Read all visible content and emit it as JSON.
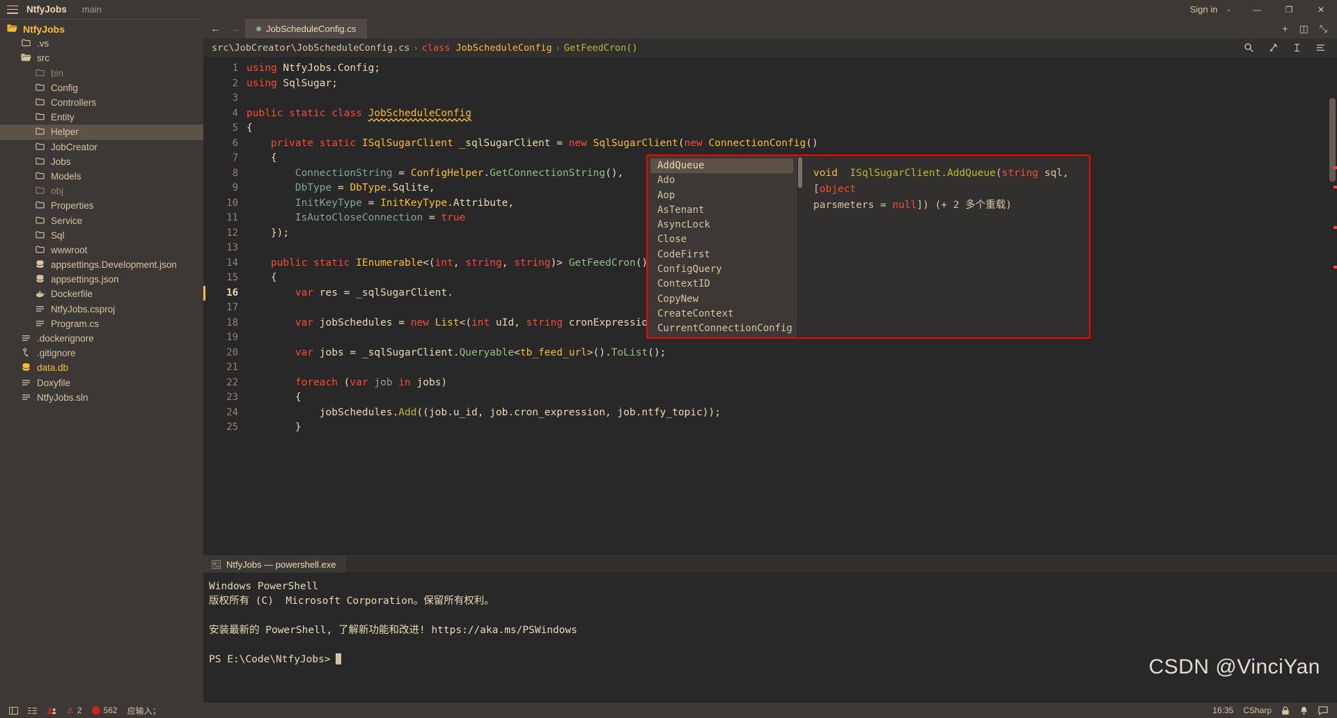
{
  "titlebar": {
    "menu_icon": "hamburger-icon",
    "project": "NtfyJobs",
    "branch": "main",
    "sign_in": "Sign in",
    "caret": "⌄",
    "minimize": "—",
    "maximize": "❐",
    "close": "✕"
  },
  "sidebar": {
    "items": [
      {
        "label": "NtfyJobs",
        "icon": "folder-open-icon",
        "indent": 0,
        "kind": "root"
      },
      {
        "label": ".vs",
        "icon": "folder-icon",
        "indent": 1,
        "kind": "folder"
      },
      {
        "label": "src",
        "icon": "folder-open-icon",
        "indent": 1,
        "kind": "folder"
      },
      {
        "label": "bin",
        "icon": "folder-icon",
        "indent": 2,
        "kind": "folder-dim"
      },
      {
        "label": "Config",
        "icon": "folder-icon",
        "indent": 2,
        "kind": "folder"
      },
      {
        "label": "Controllers",
        "icon": "folder-icon",
        "indent": 2,
        "kind": "folder"
      },
      {
        "label": "Entity",
        "icon": "folder-icon",
        "indent": 2,
        "kind": "folder"
      },
      {
        "label": "Helper",
        "icon": "folder-icon",
        "indent": 2,
        "kind": "folder-selected"
      },
      {
        "label": "JobCreator",
        "icon": "folder-icon",
        "indent": 2,
        "kind": "folder"
      },
      {
        "label": "Jobs",
        "icon": "folder-icon",
        "indent": 2,
        "kind": "folder"
      },
      {
        "label": "Models",
        "icon": "folder-icon",
        "indent": 2,
        "kind": "folder"
      },
      {
        "label": "obj",
        "icon": "folder-icon",
        "indent": 2,
        "kind": "folder-dim"
      },
      {
        "label": "Properties",
        "icon": "folder-icon",
        "indent": 2,
        "kind": "folder"
      },
      {
        "label": "Service",
        "icon": "folder-icon",
        "indent": 2,
        "kind": "folder"
      },
      {
        "label": "Sql",
        "icon": "folder-icon",
        "indent": 2,
        "kind": "folder"
      },
      {
        "label": "wwwroot",
        "icon": "folder-icon",
        "indent": 2,
        "kind": "folder"
      },
      {
        "label": "appsettings.Development.json",
        "icon": "database-icon",
        "indent": 2,
        "kind": "file"
      },
      {
        "label": "appsettings.json",
        "icon": "database-icon",
        "indent": 2,
        "kind": "file"
      },
      {
        "label": "Dockerfile",
        "icon": "docker-icon",
        "indent": 2,
        "kind": "file"
      },
      {
        "label": "NtfyJobs.csproj",
        "icon": "lines-icon",
        "indent": 2,
        "kind": "file"
      },
      {
        "label": "Program.cs",
        "icon": "lines-icon",
        "indent": 2,
        "kind": "file"
      },
      {
        "label": ".dockerignore",
        "icon": "lines-icon",
        "indent": 1,
        "kind": "file"
      },
      {
        "label": ".gitignore",
        "icon": "git-icon",
        "indent": 1,
        "kind": "file"
      },
      {
        "label": "data.db",
        "icon": "database-icon",
        "indent": 1,
        "kind": "file-db"
      },
      {
        "label": "Doxyfile",
        "icon": "lines-icon",
        "indent": 1,
        "kind": "file"
      },
      {
        "label": "NtfyJobs.sln",
        "icon": "lines-icon",
        "indent": 1,
        "kind": "file"
      }
    ]
  },
  "tabstrip": {
    "back": "←",
    "forward": "→",
    "tab_label": "JobScheduleConfig.cs",
    "add": "+",
    "split": "◫",
    "expand": "⤡"
  },
  "breadcrumb": {
    "path": "src\\JobCreator\\JobScheduleConfig.cs",
    "sep": "›",
    "keyword": "class",
    "type": "JobScheduleConfig",
    "member": "GetFeedCron()",
    "search_icon": "search-icon",
    "pin_icon": "pin-icon",
    "format_icon": "format-icon",
    "menu_icon": "more-icon"
  },
  "code": {
    "first_line": 1,
    "current_line": 16,
    "lines": [
      {
        "n": 1,
        "html": "<span class='k'>using</span> NtfyJobs.Config;"
      },
      {
        "n": 2,
        "html": "<span class='k'>using</span> SqlSugar;"
      },
      {
        "n": 3,
        "html": ""
      },
      {
        "n": 4,
        "html": "<span class='k'>public static class</span> <span class='t squig'>JobScheduleConfig</span>"
      },
      {
        "n": 5,
        "html": "{"
      },
      {
        "n": 6,
        "html": "    <span class='k'>private static</span> <span class='t'>ISqlSugarClient</span> _sqlSugarClient = <span class='k'>new</span> <span class='t'>SqlSugarClient</span>(<span class='k'>new</span> <span class='t'>ConnectionConfig</span>()"
      },
      {
        "n": 7,
        "html": "    {"
      },
      {
        "n": 8,
        "html": "        <span class='v'>ConnectionString</span> = <span class='t'>ConfigHelper</span>.<span class='m'>GetConnectionString</span>(),"
      },
      {
        "n": 9,
        "html": "        <span class='v'>DbType</span> = <span class='t'>DbType</span>.Sqlite,"
      },
      {
        "n": 10,
        "html": "        <span class='v'>InitKeyType</span> = <span class='t'>InitKeyType</span>.Attribute,"
      },
      {
        "n": 11,
        "html": "        <span class='v'>IsAutoCloseConnection</span> = <span class='k'>true</span>"
      },
      {
        "n": 12,
        "html": "    });"
      },
      {
        "n": 13,
        "html": ""
      },
      {
        "n": 14,
        "html": "    <span class='k'>public static</span> <span class='t'>IEnumerable</span>&lt;(<span class='k'>int</span>, <span class='k'>string</span>, <span class='k'>string</span>)&gt; <span class='m'>GetFeedCron</span>()"
      },
      {
        "n": 15,
        "html": "    {"
      },
      {
        "n": 16,
        "html": "        <span class='k'>var</span> res = _sqlSugarClient."
      },
      {
        "n": 17,
        "html": ""
      },
      {
        "n": 18,
        "html": "        <span class='k'>var</span> jobSchedules = <span class='k'>new</span> <span class='t'>List</span>&lt;(<span class='k'>int</span> uId, <span class='k'>string</span> cronExpression, <span class='k'>string</span> ntfyTopic)&gt;();"
      },
      {
        "n": 19,
        "html": ""
      },
      {
        "n": 20,
        "html": "        <span class='k'>var</span> jobs = _sqlSugarClient.<span class='m'>Queryable</span>&lt;<span class='t'>tb_feed_url</span>&gt;().<span class='m'>ToList</span>();"
      },
      {
        "n": 21,
        "html": ""
      },
      {
        "n": 22,
        "html": "        <span class='k'>foreach</span> (<span class='k'>var</span> <span class='v'>job</span> <span class='k'>in</span> jobs)"
      },
      {
        "n": 23,
        "html": "        {"
      },
      {
        "n": 24,
        "html": "            jobSchedules.<span class='g'>Add</span>((job.u_id, job.cron_expression, job.ntfy_topic));"
      },
      {
        "n": 25,
        "html": "        }"
      }
    ]
  },
  "intellisense": {
    "items": [
      "AddQueue",
      "Ado",
      "Aop",
      "AsTenant",
      "AsyncLock",
      "Close",
      "CodeFirst",
      "ConfigQuery",
      "ContextID",
      "CopyNew",
      "CreateContext",
      "CurrentConnectionConfig"
    ],
    "selected": "AddQueue",
    "signature": {
      "return_type": "void",
      "declaring_type": "ISqlSugarClient",
      "dot": ".",
      "method": "AddQueue",
      "open_paren": "(",
      "param1_type": "string",
      "param1_name": " sql",
      "comma": ", [",
      "param2_type": "object",
      "param2_name": "parsmeters",
      "equals": " = ",
      "param2_default": "null",
      "close": "])",
      "overloads": "(+ 2 多个重载)"
    }
  },
  "terminal": {
    "tab_label": "NtfyJobs — powershell.exe",
    "tab_icon": "terminal-icon",
    "lines": [
      "Windows PowerShell",
      "版权所有 (C)  Microsoft Corporation。保留所有权利。",
      "",
      "安装最新的 PowerShell, 了解新功能和改进! https://aka.ms/PSWindows",
      "",
      "PS E:\\Code\\NtfyJobs>"
    ]
  },
  "statusbar": {
    "left_items": [
      {
        "icon": "layout-icon",
        "label": ""
      },
      {
        "icon": "list-icon",
        "label": ""
      },
      {
        "icon": "people-icon",
        "label": ""
      },
      {
        "icon": "error-icon",
        "label": "2"
      },
      {
        "icon": "record-icon",
        "label": "562"
      },
      {
        "icon": "",
        "label": "应输入；"
      }
    ],
    "right_items": [
      {
        "icon": "",
        "label": "16:35"
      },
      {
        "icon": "",
        "label": "CSharp"
      },
      {
        "icon": "lock-icon",
        "label": ""
      },
      {
        "icon": "bell-icon",
        "label": ""
      },
      {
        "icon": "feedback-icon",
        "label": ""
      }
    ]
  },
  "watermark": "CSDN @VinciYan"
}
